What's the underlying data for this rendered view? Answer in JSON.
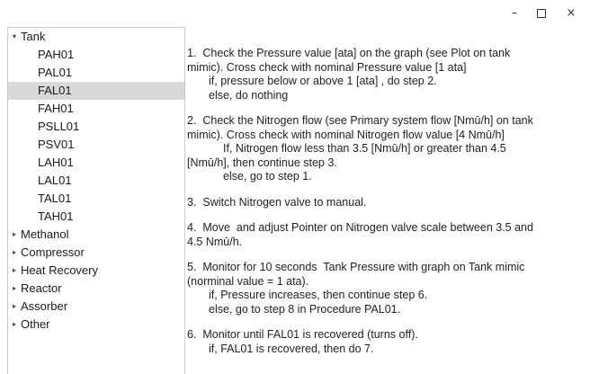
{
  "window": {
    "minimize": "–",
    "close": "×"
  },
  "tree": [
    {
      "label": "Tank",
      "expanded": true,
      "children": [
        "PAH01",
        "PAL01",
        "FAL01",
        "FAH01",
        "PSLL01",
        "PSV01",
        "LAH01",
        "LAL01",
        "TAL01",
        "TAH01"
      ],
      "selected": "FAL01"
    },
    {
      "label": "Methanol"
    },
    {
      "label": "Compressor"
    },
    {
      "label": "Heat Recovery"
    },
    {
      "label": "Reactor"
    },
    {
      "label": "Assorber"
    },
    {
      "label": "Other"
    }
  ],
  "tree_icons": {
    "expanded": "chevron-down-icon",
    "collapsed": "chevron-right-icon"
  },
  "steps": {
    "s1": {
      "l1": "1.  Check the Pressure value [ata] on the graph (see Plot on tank",
      "l2": "mimic). Cross check with nominal Pressure value [1 ata]",
      "l3": "if, pressure below or above 1 [ata] , do step 2.",
      "l4": "else, do nothing"
    },
    "s2": {
      "l1": "2.  Check the Nitrogen flow (see Primary system flow [Nmū/h] on tank",
      "l2": "mimic). Cross check with nominal Nitrogen flow value [4 Nmū/h]",
      "l3": "If, Nitrogen flow less than 3.5 [Nmū/h] or greater than 4.5",
      "l4": "[Nmū/h], then continue step 3.",
      "l5": "else, go to step 1."
    },
    "s3": {
      "l1": "3.  Switch Nitrogen valve to manual."
    },
    "s4": {
      "l1": "4.  Move  and adjust Pointer on Nitrogen valve scale between 3.5 and",
      "l2": "4.5 Nmū/h."
    },
    "s5": {
      "l1": "5.  Monitor for 10 seconds  Tank Pressure with graph on Tank mimic",
      "l2": "(norminal value = 1 ata).",
      "l3": "if, Pressure increases, then continue step 6.",
      "l4": "else, go to step 8 in Procedure PAL01."
    },
    "s6": {
      "l1": "6.  Monitor until FAL01 is recovered (turns off).",
      "l2": "if, FAL01 is recovered, then do 7."
    }
  }
}
